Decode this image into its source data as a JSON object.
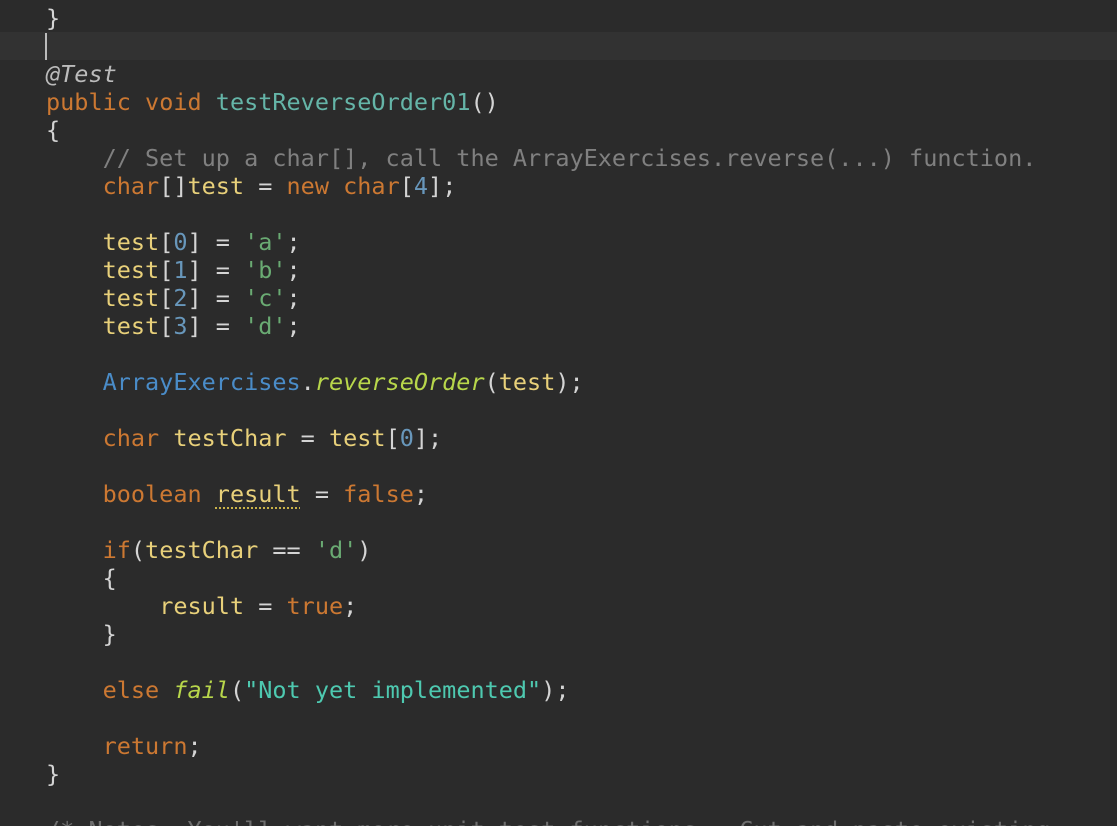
{
  "editor": {
    "lines": [
      {
        "tokens": [
          {
            "t": "}",
            "c": "plain"
          }
        ]
      },
      {
        "tokens": []
      },
      {
        "tokens": [
          {
            "t": "@Test",
            "c": "ann"
          }
        ]
      },
      {
        "tokens": [
          {
            "t": "public",
            "c": "kw"
          },
          {
            "t": " ",
            "c": "plain"
          },
          {
            "t": "void",
            "c": "kw"
          },
          {
            "t": " ",
            "c": "plain"
          },
          {
            "t": "testReverseOrder01",
            "c": "fn-decl"
          },
          {
            "t": "()",
            "c": "punct"
          }
        ]
      },
      {
        "tokens": [
          {
            "t": "{",
            "c": "plain"
          }
        ]
      },
      {
        "tokens": [
          {
            "t": "    // Set up a char[], call the ArrayExercises.reverse(...) function.",
            "c": "comment"
          }
        ]
      },
      {
        "tokens": [
          {
            "t": "    ",
            "c": "plain"
          },
          {
            "t": "char",
            "c": "kw"
          },
          {
            "t": "[]",
            "c": "punct"
          },
          {
            "t": "test",
            "c": "ident"
          },
          {
            "t": " = ",
            "c": "plain"
          },
          {
            "t": "new",
            "c": "kw"
          },
          {
            "t": " ",
            "c": "plain"
          },
          {
            "t": "char",
            "c": "kw"
          },
          {
            "t": "[",
            "c": "punct"
          },
          {
            "t": "4",
            "c": "num"
          },
          {
            "t": "];",
            "c": "punct"
          }
        ]
      },
      {
        "tokens": []
      },
      {
        "tokens": [
          {
            "t": "    ",
            "c": "plain"
          },
          {
            "t": "test",
            "c": "ident"
          },
          {
            "t": "[",
            "c": "punct"
          },
          {
            "t": "0",
            "c": "num"
          },
          {
            "t": "] = ",
            "c": "punct"
          },
          {
            "t": "'a'",
            "c": "str"
          },
          {
            "t": ";",
            "c": "punct"
          }
        ]
      },
      {
        "tokens": [
          {
            "t": "    ",
            "c": "plain"
          },
          {
            "t": "test",
            "c": "ident"
          },
          {
            "t": "[",
            "c": "punct"
          },
          {
            "t": "1",
            "c": "num"
          },
          {
            "t": "] = ",
            "c": "punct"
          },
          {
            "t": "'b'",
            "c": "str"
          },
          {
            "t": ";",
            "c": "punct"
          }
        ]
      },
      {
        "tokens": [
          {
            "t": "    ",
            "c": "plain"
          },
          {
            "t": "test",
            "c": "ident"
          },
          {
            "t": "[",
            "c": "punct"
          },
          {
            "t": "2",
            "c": "num"
          },
          {
            "t": "] = ",
            "c": "punct"
          },
          {
            "t": "'c'",
            "c": "str"
          },
          {
            "t": ";",
            "c": "punct"
          }
        ]
      },
      {
        "tokens": [
          {
            "t": "    ",
            "c": "plain"
          },
          {
            "t": "test",
            "c": "ident"
          },
          {
            "t": "[",
            "c": "punct"
          },
          {
            "t": "3",
            "c": "num"
          },
          {
            "t": "] = ",
            "c": "punct"
          },
          {
            "t": "'d'",
            "c": "str"
          },
          {
            "t": ";",
            "c": "punct"
          }
        ]
      },
      {
        "tokens": []
      },
      {
        "tokens": [
          {
            "t": "    ",
            "c": "plain"
          },
          {
            "t": "ArrayExercises",
            "c": "cls"
          },
          {
            "t": ".",
            "c": "punct"
          },
          {
            "t": "reverseOrder",
            "c": "static-call"
          },
          {
            "t": "(",
            "c": "punct"
          },
          {
            "t": "test",
            "c": "ident"
          },
          {
            "t": ");",
            "c": "punct"
          }
        ]
      },
      {
        "tokens": []
      },
      {
        "tokens": [
          {
            "t": "    ",
            "c": "plain"
          },
          {
            "t": "char",
            "c": "kw"
          },
          {
            "t": " ",
            "c": "plain"
          },
          {
            "t": "testChar",
            "c": "ident"
          },
          {
            "t": " = ",
            "c": "plain"
          },
          {
            "t": "test",
            "c": "ident"
          },
          {
            "t": "[",
            "c": "punct"
          },
          {
            "t": "0",
            "c": "num"
          },
          {
            "t": "];",
            "c": "punct"
          }
        ]
      },
      {
        "tokens": []
      },
      {
        "tokens": [
          {
            "t": "    ",
            "c": "plain"
          },
          {
            "t": "boolean",
            "c": "kw"
          },
          {
            "t": " ",
            "c": "plain"
          },
          {
            "t": "result",
            "c": "ident warn"
          },
          {
            "t": " = ",
            "c": "plain"
          },
          {
            "t": "false",
            "c": "kw"
          },
          {
            "t": ";",
            "c": "punct"
          }
        ]
      },
      {
        "tokens": []
      },
      {
        "tokens": [
          {
            "t": "    ",
            "c": "plain"
          },
          {
            "t": "if",
            "c": "kw"
          },
          {
            "t": "(",
            "c": "punct"
          },
          {
            "t": "testChar",
            "c": "ident"
          },
          {
            "t": " == ",
            "c": "plain"
          },
          {
            "t": "'d'",
            "c": "str"
          },
          {
            "t": ")",
            "c": "punct"
          }
        ]
      },
      {
        "tokens": [
          {
            "t": "    {",
            "c": "plain"
          }
        ]
      },
      {
        "tokens": [
          {
            "t": "        ",
            "c": "plain"
          },
          {
            "t": "result",
            "c": "ident"
          },
          {
            "t": " = ",
            "c": "plain"
          },
          {
            "t": "true",
            "c": "kw"
          },
          {
            "t": ";",
            "c": "punct"
          }
        ]
      },
      {
        "tokens": [
          {
            "t": "    }",
            "c": "plain"
          }
        ]
      },
      {
        "tokens": []
      },
      {
        "tokens": [
          {
            "t": "    ",
            "c": "plain"
          },
          {
            "t": "else",
            "c": "kw"
          },
          {
            "t": " ",
            "c": "plain"
          },
          {
            "t": "fail",
            "c": "static-call"
          },
          {
            "t": "(",
            "c": "punct"
          },
          {
            "t": "\"Not yet implemented\"",
            "c": "str2"
          },
          {
            "t": ");",
            "c": "punct"
          }
        ]
      },
      {
        "tokens": []
      },
      {
        "tokens": [
          {
            "t": "    ",
            "c": "plain"
          },
          {
            "t": "return",
            "c": "kw"
          },
          {
            "t": ";",
            "c": "punct"
          }
        ]
      },
      {
        "tokens": [
          {
            "t": "}",
            "c": "plain"
          }
        ]
      },
      {
        "tokens": []
      },
      {
        "tokens": [
          {
            "t": "/* Notes: You'll want more unit test functions.  Cut and paste existing",
            "c": "comment faded"
          }
        ]
      }
    ]
  }
}
